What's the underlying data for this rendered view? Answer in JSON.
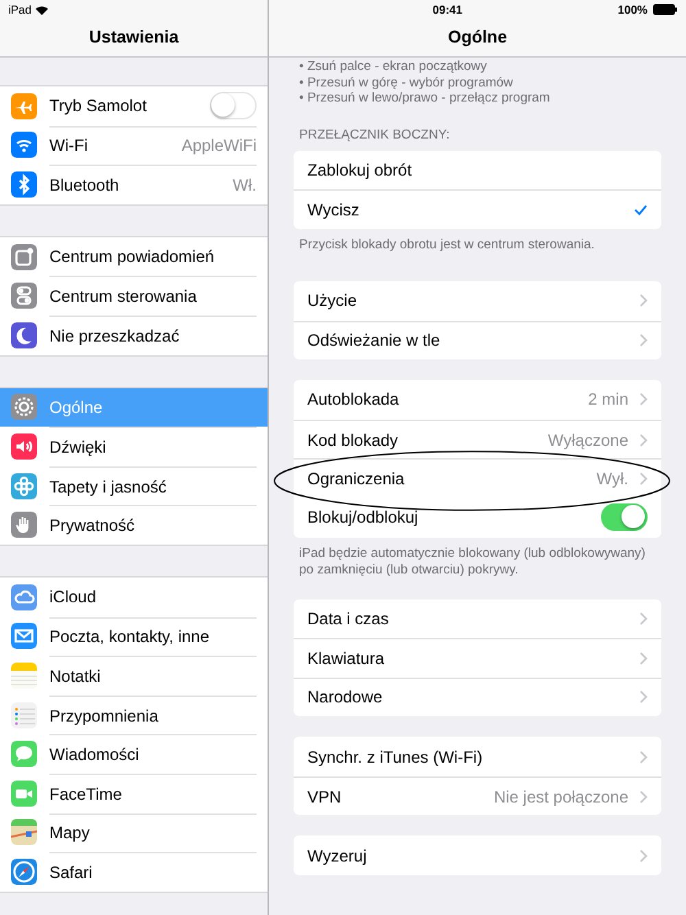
{
  "status_bar": {
    "device": "iPad",
    "time": "09:41",
    "battery": "100%"
  },
  "sidebar": {
    "title": "Ustawienia",
    "groups": [
      [
        {
          "label": "Tryb Samolot",
          "color": "#ff9500",
          "kind": "toggle",
          "on": false
        },
        {
          "label": "Wi-Fi",
          "color": "#007aff",
          "kind": "value",
          "value": "AppleWiFi"
        },
        {
          "label": "Bluetooth",
          "color": "#007aff",
          "kind": "value",
          "value": "Wł."
        }
      ],
      [
        {
          "label": "Centrum powiadomień",
          "color": "#8e8e93",
          "kind": "plain"
        },
        {
          "label": "Centrum sterowania",
          "color": "#8e8e93",
          "kind": "plain"
        },
        {
          "label": "Nie przeszkadzać",
          "color": "#5856d6",
          "kind": "plain"
        }
      ],
      [
        {
          "label": "Ogólne",
          "color": "#8e8e93",
          "kind": "plain",
          "selected": true
        },
        {
          "label": "Dźwięki",
          "color": "#ff2d55",
          "kind": "plain",
          "selected": false
        },
        {
          "label": "Tapety i jasność",
          "color": "#34aadc",
          "kind": "plain",
          "selected": false
        },
        {
          "label": "Prywatność",
          "color": "#8e8e93",
          "kind": "plain",
          "selected": false
        }
      ],
      [
        {
          "label": "iCloud",
          "color": "#5b9bf0",
          "kind": "plain"
        },
        {
          "label": "Poczta, kontakty, inne",
          "color": "#1e90ff",
          "kind": "plain"
        },
        {
          "label": "Notatki",
          "color": "#ffcc00",
          "kind": "plain"
        },
        {
          "label": "Przypomnienia",
          "color": "#f2f2f2",
          "kind": "plain"
        },
        {
          "label": "Wiadomości",
          "color": "#4cd964",
          "kind": "plain"
        },
        {
          "label": "FaceTime",
          "color": "#4cd964",
          "kind": "plain"
        },
        {
          "label": "Mapy",
          "color": "#e8dcb0",
          "kind": "plain"
        },
        {
          "label": "Safari",
          "color": "#1e88e5",
          "kind": "plain"
        }
      ]
    ]
  },
  "detail": {
    "title": "Ogólne",
    "intro_lines": [
      "• Zsuń palce - ekran początkowy",
      "• Przesuń w górę - wybór programów",
      "• Przesuń w lewo/prawo - przełącz program"
    ],
    "groups": [
      {
        "header": "PRZEŁĄCZNIK BOCZNY:",
        "rows": [
          {
            "label": "Zablokuj obrót",
            "kind": "check",
            "checked": false
          },
          {
            "label": "Wycisz",
            "kind": "check",
            "checked": true
          }
        ],
        "footer": "Przycisk blokady obrotu jest w centrum sterowania."
      },
      {
        "rows": [
          {
            "label": "Użycie",
            "kind": "link"
          },
          {
            "label": "Odświeżanie w tle",
            "kind": "link"
          }
        ]
      },
      {
        "rows": [
          {
            "label": "Autoblokada",
            "kind": "link",
            "value": "2 min"
          },
          {
            "label": "Kod blokady",
            "kind": "link",
            "value": "Wyłączone"
          },
          {
            "label": "Ograniczenia",
            "kind": "link",
            "value": "Wył.",
            "circled": true
          },
          {
            "label": "Blokuj/odblokuj",
            "kind": "toggle",
            "on": true
          }
        ],
        "footer": "iPad będzie automatycznie blokowany (lub odblokowywany) po zamknięciu (lub otwarciu) pokrywy."
      },
      {
        "rows": [
          {
            "label": "Data i czas",
            "kind": "link"
          },
          {
            "label": "Klawiatura",
            "kind": "link"
          },
          {
            "label": "Narodowe",
            "kind": "link"
          }
        ]
      },
      {
        "rows": [
          {
            "label": "Synchr. z iTunes (Wi-Fi)",
            "kind": "link"
          },
          {
            "label": "VPN",
            "kind": "link",
            "value": "Nie jest połączone"
          }
        ]
      },
      {
        "rows": [
          {
            "label": "Wyzeruj",
            "kind": "link"
          }
        ]
      }
    ]
  }
}
